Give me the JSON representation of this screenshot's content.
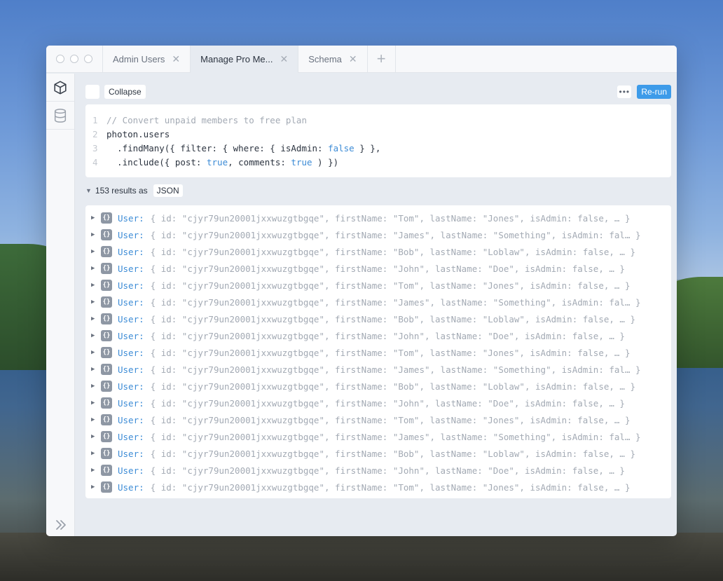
{
  "window": {
    "tabs": [
      {
        "label": "Admin Users",
        "active": false
      },
      {
        "label": "Manage Pro Me...",
        "active": true
      },
      {
        "label": "Schema",
        "active": false
      }
    ]
  },
  "sidebar": {
    "items": [
      {
        "icon": "cube-icon"
      },
      {
        "icon": "database-icon"
      }
    ],
    "expand_icon": "double-chevron-right-icon"
  },
  "toolbar": {
    "collapse_label": "Collapse",
    "more_label": "•••",
    "rerun_label": "Re-run"
  },
  "editor": {
    "lines": [
      {
        "n": "1",
        "parts": [
          {
            "t": "cm",
            "v": "// Convert unpaid members to free plan"
          }
        ]
      },
      {
        "n": "2",
        "parts": [
          {
            "t": "code",
            "v": "photon.users"
          }
        ]
      },
      {
        "n": "3",
        "parts": [
          {
            "t": "code",
            "v": "  .findMany({ filter: { where: { isAdmin: "
          },
          {
            "t": "kw",
            "v": "false"
          },
          {
            "t": "code",
            "v": " } },"
          }
        ]
      },
      {
        "n": "4",
        "parts": [
          {
            "t": "code",
            "v": "  .include({ post: "
          },
          {
            "t": "kw",
            "v": "true"
          },
          {
            "t": "code",
            "v": ", comments: "
          },
          {
            "t": "kw",
            "v": "true"
          },
          {
            "t": "code",
            "v": " ) })"
          }
        ]
      }
    ]
  },
  "results": {
    "summary": "153 results as",
    "format": "JSON",
    "rows": [
      {
        "type": "User:",
        "value": "{ id: \"cjyr79un20001jxxwuzgtbgqe\", firstName: \"Tom\", lastName: \"Jones\", isAdmin: false, … }"
      },
      {
        "type": "User:",
        "value": "{ id: \"cjyr79un20001jxxwuzgtbgqe\", firstName: \"James\", lastName: \"Something\", isAdmin: fal… }"
      },
      {
        "type": "User:",
        "value": "{ id: \"cjyr79un20001jxxwuzgtbgqe\", firstName: \"Bob\", lastName: \"Loblaw\", isAdmin: false, … }"
      },
      {
        "type": "User:",
        "value": "{ id: \"cjyr79un20001jxxwuzgtbgqe\", firstName: \"John\", lastName: \"Doe\", isAdmin: false, … }"
      },
      {
        "type": "User:",
        "value": "{ id: \"cjyr79un20001jxxwuzgtbgqe\", firstName: \"Tom\", lastName: \"Jones\", isAdmin: false, … }"
      },
      {
        "type": "User:",
        "value": "{ id: \"cjyr79un20001jxxwuzgtbgqe\", firstName: \"James\", lastName: \"Something\", isAdmin: fal… }"
      },
      {
        "type": "User:",
        "value": "{ id: \"cjyr79un20001jxxwuzgtbgqe\", firstName: \"Bob\", lastName: \"Loblaw\", isAdmin: false, … }"
      },
      {
        "type": "User:",
        "value": "{ id: \"cjyr79un20001jxxwuzgtbgqe\", firstName: \"John\", lastName: \"Doe\", isAdmin: false, … }"
      },
      {
        "type": "User:",
        "value": "{ id: \"cjyr79un20001jxxwuzgtbgqe\", firstName: \"Tom\", lastName: \"Jones\", isAdmin: false, … }"
      },
      {
        "type": "User:",
        "value": "{ id: \"cjyr79un20001jxxwuzgtbgqe\", firstName: \"James\", lastName: \"Something\", isAdmin: fal… }"
      },
      {
        "type": "User:",
        "value": "{ id: \"cjyr79un20001jxxwuzgtbgqe\", firstName: \"Bob\", lastName: \"Loblaw\", isAdmin: false, … }"
      },
      {
        "type": "User:",
        "value": "{ id: \"cjyr79un20001jxxwuzgtbgqe\", firstName: \"John\", lastName: \"Doe\", isAdmin: false, … }"
      },
      {
        "type": "User:",
        "value": "{ id: \"cjyr79un20001jxxwuzgtbgqe\", firstName: \"Tom\", lastName: \"Jones\", isAdmin: false, … }"
      },
      {
        "type": "User:",
        "value": "{ id: \"cjyr79un20001jxxwuzgtbgqe\", firstName: \"James\", lastName: \"Something\", isAdmin: fal… }"
      },
      {
        "type": "User:",
        "value": "{ id: \"cjyr79un20001jxxwuzgtbgqe\", firstName: \"Bob\", lastName: \"Loblaw\", isAdmin: false, … }"
      },
      {
        "type": "User:",
        "value": "{ id: \"cjyr79un20001jxxwuzgtbgqe\", firstName: \"John\", lastName: \"Doe\", isAdmin: false, … }"
      },
      {
        "type": "User:",
        "value": "{ id: \"cjyr79un20001jxxwuzgtbgqe\", firstName: \"Tom\", lastName: \"Jones\", isAdmin: false, … }"
      }
    ]
  },
  "colors": {
    "accent": "#3d9be9",
    "keyword": "#3d8cd6",
    "comment": "#a3aab4"
  }
}
